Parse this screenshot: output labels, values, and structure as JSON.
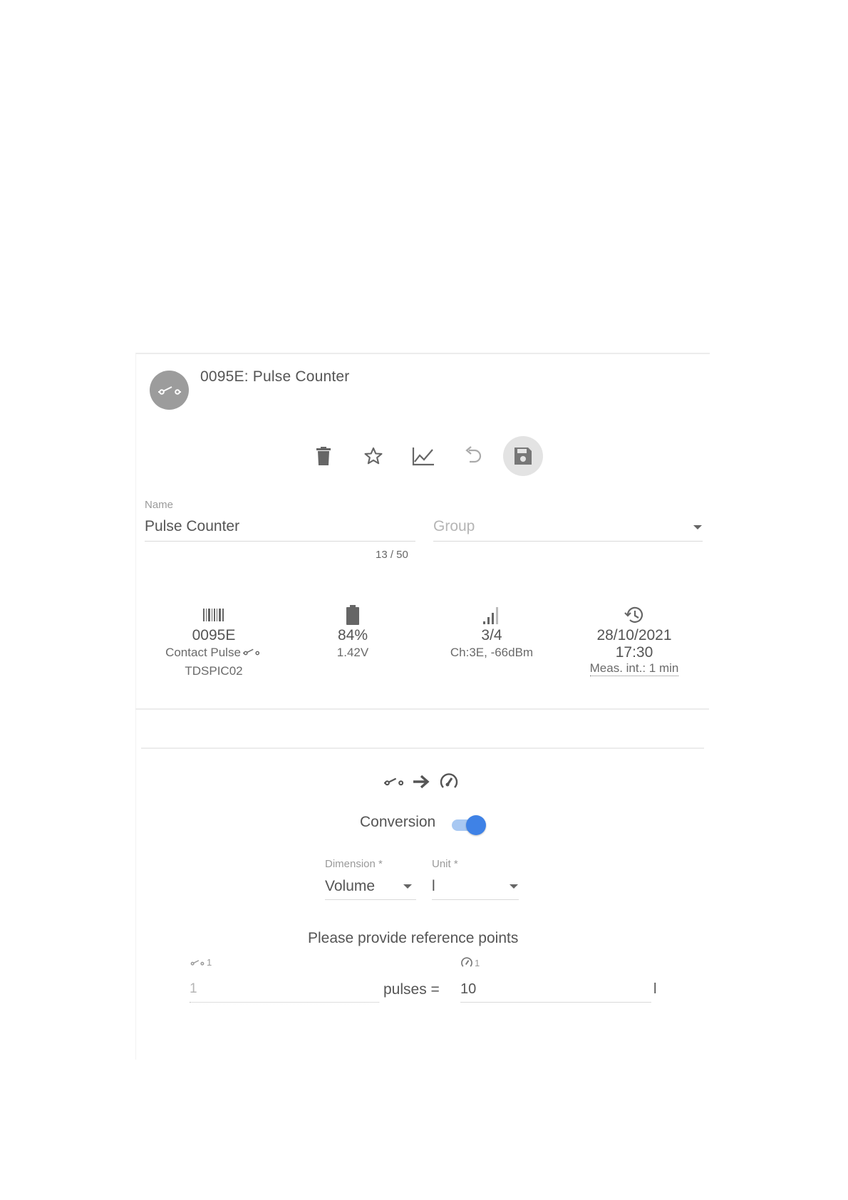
{
  "header": {
    "title": "0095E: Pulse Counter",
    "avatar_icon": "contact-switch-icon",
    "avatar_color": "#9c9c9c"
  },
  "toolbar": {
    "buttons": [
      {
        "name": "delete",
        "icon": "trash-icon"
      },
      {
        "name": "favorite",
        "icon": "star-outline-icon"
      },
      {
        "name": "chart",
        "icon": "line-chart-icon"
      },
      {
        "name": "undo",
        "icon": "undo-icon"
      },
      {
        "name": "save",
        "icon": "floppy-disk-icon"
      }
    ]
  },
  "form": {
    "name_label": "Name",
    "name_value": "Pulse Counter",
    "name_counter": "13 / 50",
    "group_placeholder": "Group"
  },
  "info": {
    "id": {
      "icon": "barcode-icon",
      "main": "0095E",
      "type": "Contact Pulse",
      "model": "TDSPIC02"
    },
    "battery": {
      "icon": "battery-icon",
      "percent": "84%",
      "voltage": "1.42V"
    },
    "signal": {
      "icon": "signal-bars-icon",
      "level": "3/4",
      "channel": "Ch:3E, -66dBm"
    },
    "last": {
      "icon": "history-icon",
      "date": "28/10/2021",
      "time": "17:30",
      "interval": "Meas. int.: 1 min"
    }
  },
  "conversion": {
    "label": "Conversion",
    "enabled": true,
    "accent_color": "#3f82e6",
    "dimension_label": "Dimension *",
    "dimension_value": "Volume",
    "unit_label": "Unit *",
    "unit_value": "l",
    "ref_title": "Please provide reference points",
    "pulse_ref_label": "1",
    "meter_ref_label": "1",
    "pulse_value": "1",
    "pulses_text": "pulses =",
    "meter_value": "10",
    "meter_unit": "l"
  }
}
